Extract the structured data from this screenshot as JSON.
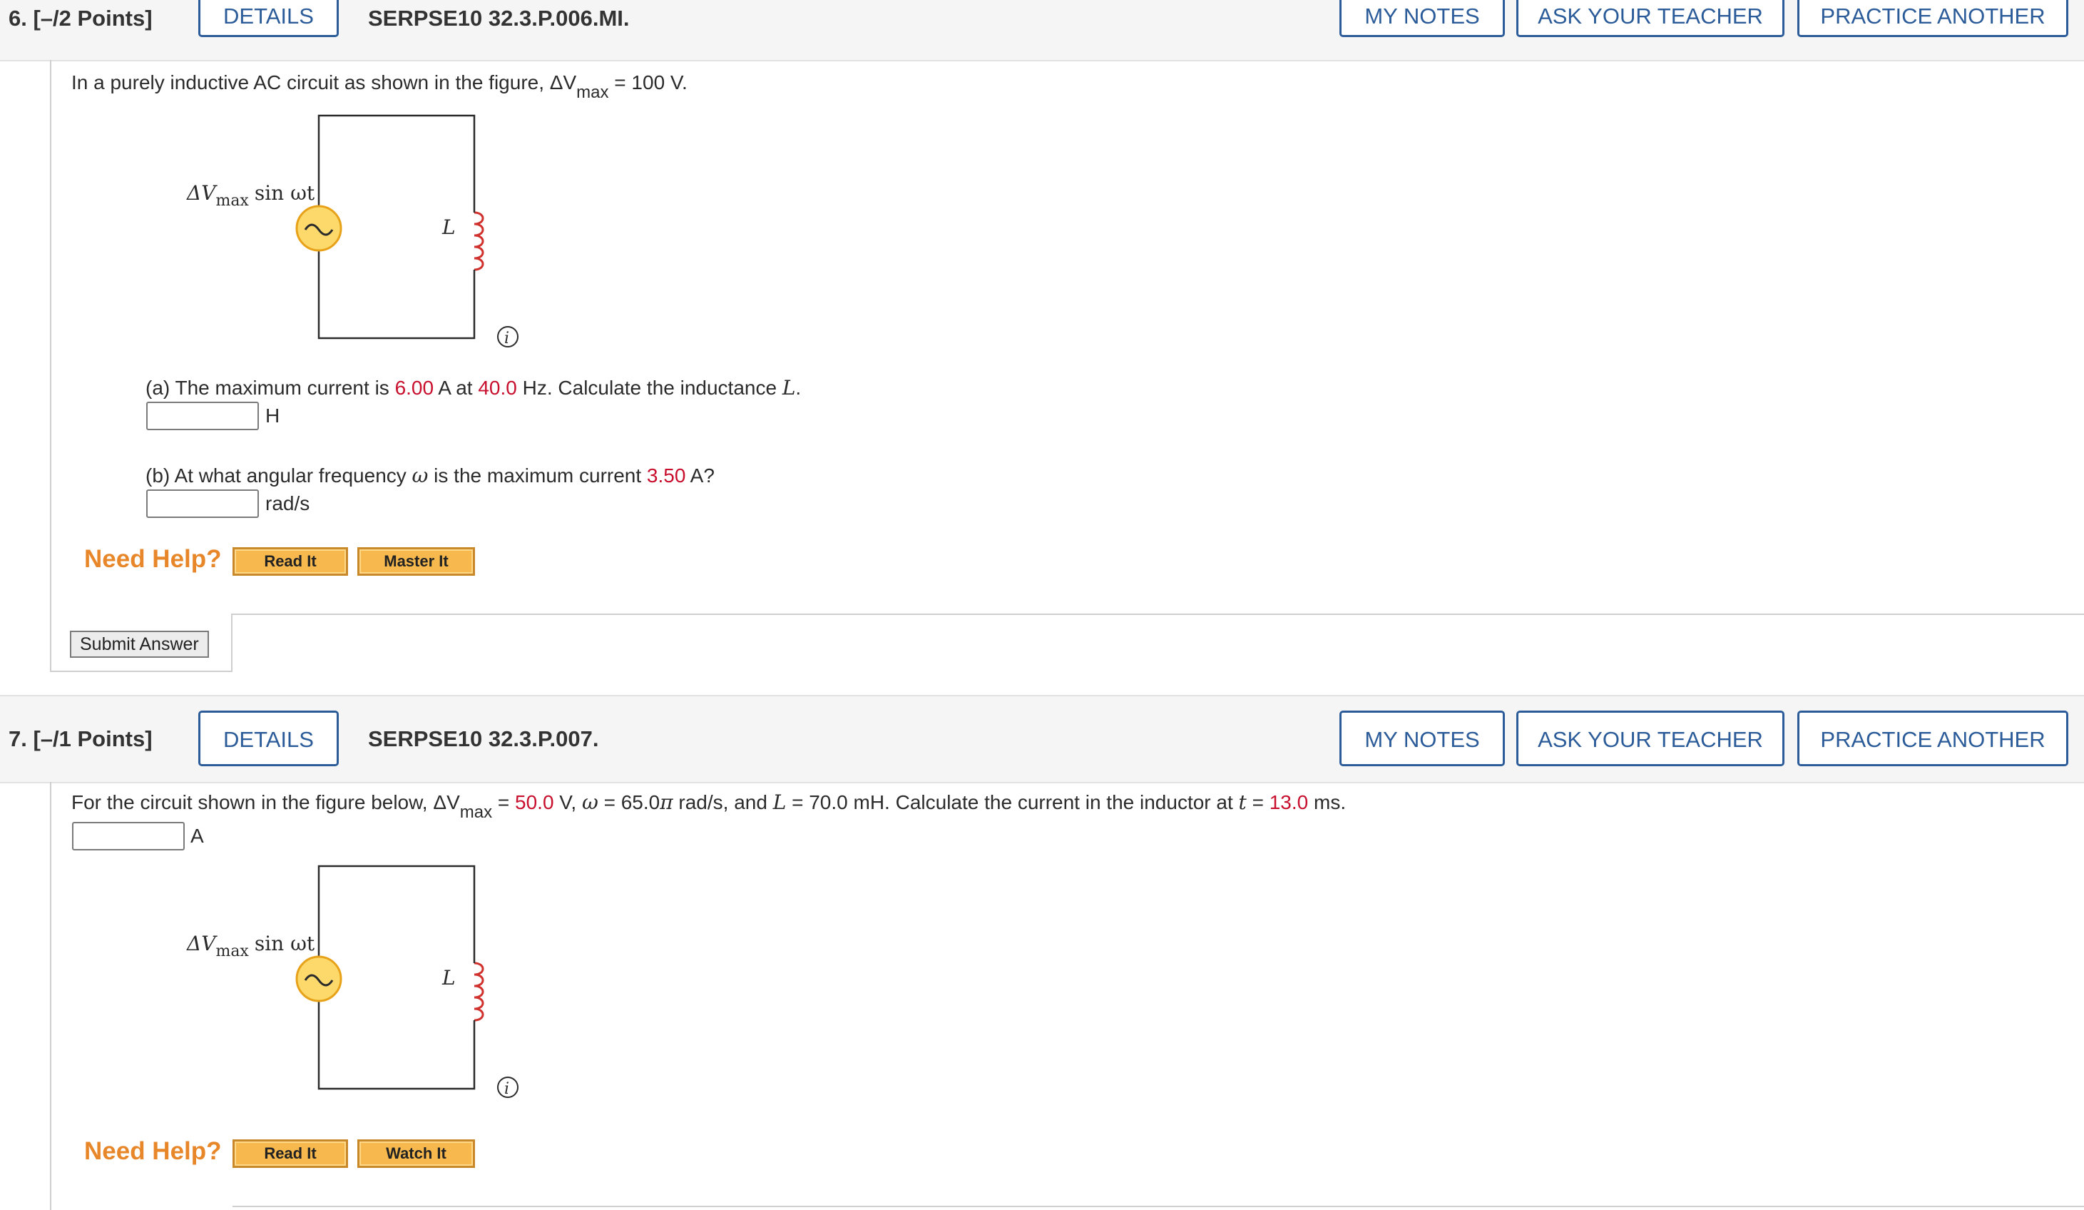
{
  "questions": [
    {
      "header": {
        "number": "6. [–/2 Points]",
        "details": "DETAILS",
        "code": "SERPSE10 32.3.P.006.MI.",
        "my_notes": "MY NOTES",
        "ask_teacher": "ASK YOUR TEACHER",
        "practice": "PRACTICE ANOTHER"
      },
      "intro": {
        "pre": "In a purely inductive AC circuit as shown in the figure, ΔV",
        "sub": "max",
        "post": " = 100 V."
      },
      "figure": {
        "source_delta": "ΔV",
        "source_sub": "max",
        "source_func": "sin ωt",
        "inductor_label": "L",
        "info_icon": "i"
      },
      "part_a": {
        "t1": "(a) The maximum current is ",
        "v1": "6.00",
        "t2": " A at ",
        "v2": "40.0",
        "t3": " Hz. Calculate the inductance ",
        "var": "L",
        "t4": ".",
        "unit": "H"
      },
      "part_b": {
        "t1": "(b) At what angular frequency ",
        "var": "ω",
        "t2": " is the maximum current ",
        "v1": "3.50",
        "t3": " A?",
        "unit": "rad/s"
      },
      "help": {
        "label": "Need Help?",
        "read": "Read It",
        "second": "Master It"
      },
      "submit": "Submit Answer"
    },
    {
      "header": {
        "number": "7. [–/1 Points]",
        "details": "DETAILS",
        "code": "SERPSE10 32.3.P.007.",
        "my_notes": "MY NOTES",
        "ask_teacher": "ASK YOUR TEACHER",
        "practice": "PRACTICE ANOTHER"
      },
      "body": {
        "t1": "For the circuit shown in the figure below, ΔV",
        "sub": "max",
        "t2": " = ",
        "v1": "50.0",
        "t3": " V, ",
        "omega": "ω",
        "t4": " = 65.0",
        "pi": "π",
        "t5": " rad/s, and ",
        "L": "L",
        "t6": " = 70.0 mH. Calculate the current in the inductor at ",
        "t": "t",
        "t7": " = ",
        "v2": "13.0",
        "t8": " ms.",
        "unit": "A"
      },
      "figure": {
        "source_delta": "ΔV",
        "source_sub": "max",
        "source_func": "sin ωt",
        "inductor_label": "L",
        "info_icon": "i"
      },
      "help": {
        "label": "Need Help?",
        "read": "Read It",
        "second": "Watch It"
      }
    }
  ],
  "colors": {
    "accent_blue": "#2b5c99",
    "value_red": "#c8102e",
    "need_help_orange": "#e8872a",
    "help_button_fill": "#f7b94d",
    "source_fill": "#fcd96a",
    "source_stroke": "#e8a21a",
    "inductor_red": "#d0312d"
  }
}
